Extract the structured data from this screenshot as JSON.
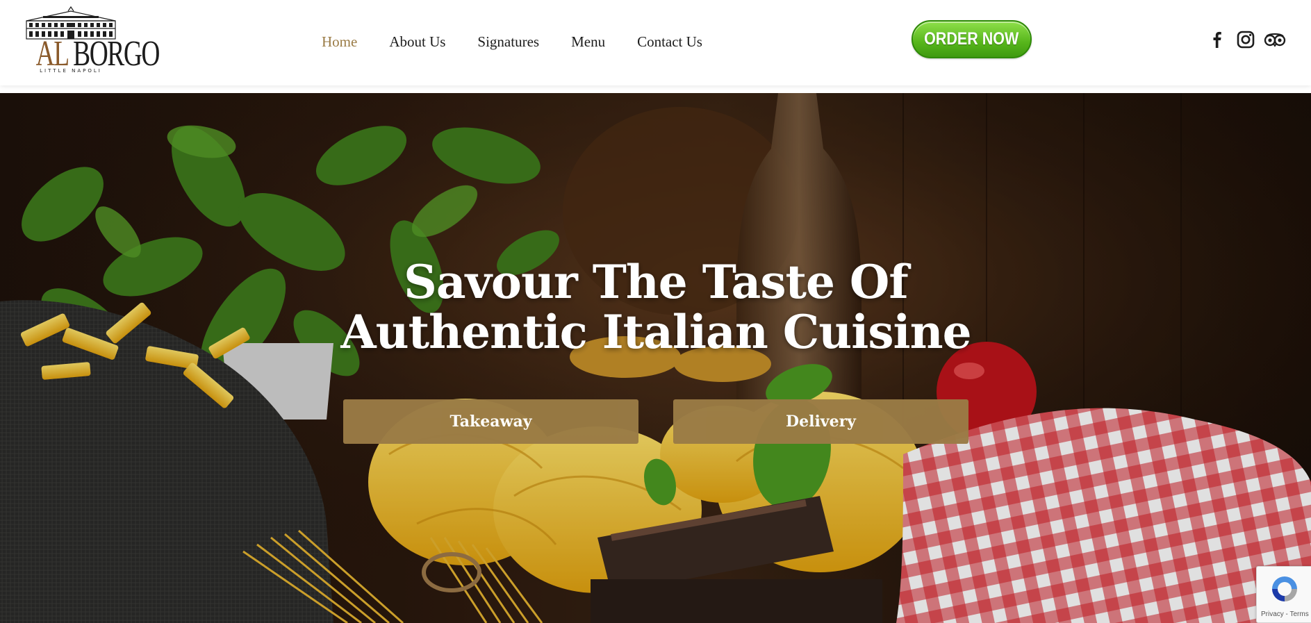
{
  "header": {
    "logo": {
      "word_left": "AL",
      "word_right": "BORGO",
      "tagline": "LITTLE NAPOLI"
    },
    "nav": [
      {
        "label": "Home",
        "active": true
      },
      {
        "label": "About Us",
        "active": false
      },
      {
        "label": "Signatures",
        "active": false
      },
      {
        "label": "Menu",
        "active": false
      },
      {
        "label": "Contact Us",
        "active": false
      }
    ],
    "order_button": "ORDER NOW",
    "social_icons": [
      "facebook-icon",
      "instagram-icon",
      "tripadvisor-icon"
    ]
  },
  "hero": {
    "title_line1": "Savour The Taste Of",
    "title_line2": "Authentic Italian Cuisine",
    "buttons": {
      "takeaway": "Takeaway",
      "delivery": "Delivery"
    }
  },
  "recaptcha": {
    "links": "Privacy - Terms"
  },
  "colors": {
    "accent": "#9a7b45",
    "nav_text": "#1c1c1c",
    "order_green": "#56b51b"
  }
}
